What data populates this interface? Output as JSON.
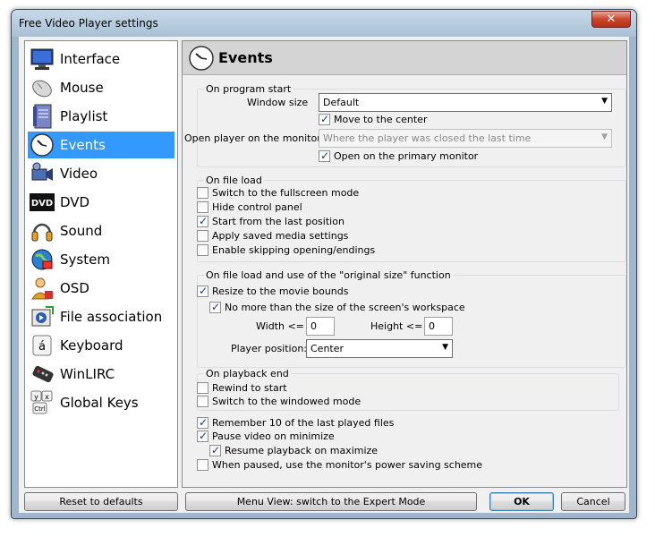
{
  "window": {
    "title": "Free Video Player settings",
    "close_glyph": "✕"
  },
  "sidebar": {
    "items": [
      {
        "label": "Interface",
        "icon": "monitor-icon"
      },
      {
        "label": "Mouse",
        "icon": "mouse-icon"
      },
      {
        "label": "Playlist",
        "icon": "playlist-icon"
      },
      {
        "label": "Events",
        "icon": "clock-icon"
      },
      {
        "label": "Video",
        "icon": "video-camera-icon"
      },
      {
        "label": "DVD",
        "icon": "dvd-icon"
      },
      {
        "label": "Sound",
        "icon": "headphones-icon"
      },
      {
        "label": "System",
        "icon": "system-globe-icon"
      },
      {
        "label": "OSD",
        "icon": "osd-person-icon"
      },
      {
        "label": "File association",
        "icon": "file-association-icon"
      },
      {
        "label": "Keyboard",
        "icon": "keyboard-key-icon"
      },
      {
        "label": "WinLIRC",
        "icon": "remote-control-icon"
      },
      {
        "label": "Global Keys",
        "icon": "global-keys-icon"
      }
    ],
    "selected": "Events"
  },
  "main": {
    "title": "Events",
    "program_start": {
      "title": "On program start",
      "window_size_label": "Window size",
      "window_size_value": "Default",
      "move_center": {
        "label": "Move to the center",
        "checked": true
      },
      "monitor_label": "Open player on the monitor",
      "monitor_value": "Where the player was closed the last time",
      "primary_monitor": {
        "label": "Open on the primary monitor",
        "checked": true
      }
    },
    "file_load": {
      "title": "On file load",
      "items": [
        {
          "label": "Switch to the fullscreen mode",
          "checked": false
        },
        {
          "label": "Hide control panel",
          "checked": false
        },
        {
          "label": "Start from the last position",
          "checked": true
        },
        {
          "label": "Apply saved media settings",
          "checked": false
        },
        {
          "label": "Enable skipping opening/endings",
          "checked": false
        }
      ]
    },
    "original_size": {
      "title": "On file load and use of the \"original size\" function",
      "resize": {
        "label": "Resize to the movie bounds",
        "checked": true
      },
      "no_more": {
        "label": "No more than the size of the screen's workspace",
        "checked": true
      },
      "width_label": "Width <=",
      "width_value": "0",
      "height_label": "Height <=",
      "height_value": "0",
      "position_label": "Player position:",
      "position_value": "Center"
    },
    "playback_end": {
      "title": "On playback end",
      "rewind": {
        "label": "Rewind to start",
        "checked": false
      },
      "windowed": {
        "label": "Switch to the windowed mode",
        "checked": false
      }
    },
    "misc": {
      "remember": {
        "label": "Remember 10 of the last played files",
        "checked": true
      },
      "pause_min": {
        "label": "Pause video on minimize",
        "checked": true
      },
      "resume_max": {
        "label": "Resume playback on maximize",
        "checked": true
      },
      "power_saving": {
        "label": "When paused, use the monitor's power saving scheme",
        "checked": false
      }
    }
  },
  "buttons": {
    "reset": "Reset to defaults",
    "expert": "Menu View: switch to the Expert Mode",
    "ok": "OK",
    "cancel": "Cancel"
  },
  "colors": {
    "selection": "#3399ff",
    "title_bar": "#a9c0d6",
    "close": "#c8442a"
  }
}
